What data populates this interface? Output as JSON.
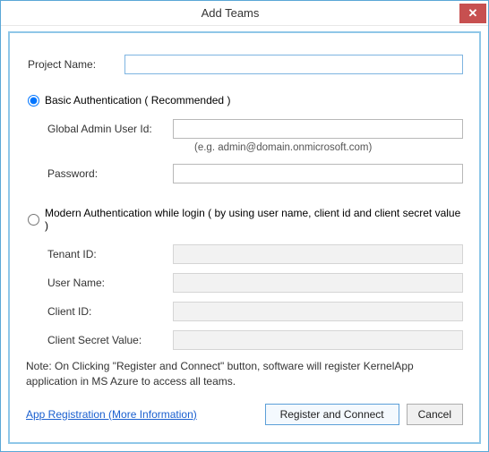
{
  "window": {
    "title": "Add Teams",
    "close_glyph": "✕"
  },
  "project": {
    "label": "Project Name:",
    "value": ""
  },
  "auth_basic": {
    "radio_label": "Basic Authentication ( Recommended )",
    "selected": true,
    "global_admin_label": "Global Admin User Id:",
    "global_admin_value": "",
    "global_admin_hint": "(e.g. admin@domain.onmicrosoft.com)",
    "password_label": "Password:",
    "password_value": ""
  },
  "auth_modern": {
    "radio_label": "Modern Authentication while login ( by using user name, client id and client secret value )",
    "selected": false,
    "tenant_id_label": "Tenant ID:",
    "tenant_id_value": "",
    "user_name_label": "User Name:",
    "user_name_value": "",
    "client_id_label": "Client ID:",
    "client_id_value": "",
    "client_secret_label": "Client Secret Value:",
    "client_secret_value": ""
  },
  "note": "Note: On Clicking \"Register and Connect\" button, software will register KernelApp application in MS Azure to access all teams.",
  "link": {
    "label": "App Registration (More Information)"
  },
  "buttons": {
    "register": "Register and Connect",
    "cancel": "Cancel"
  }
}
